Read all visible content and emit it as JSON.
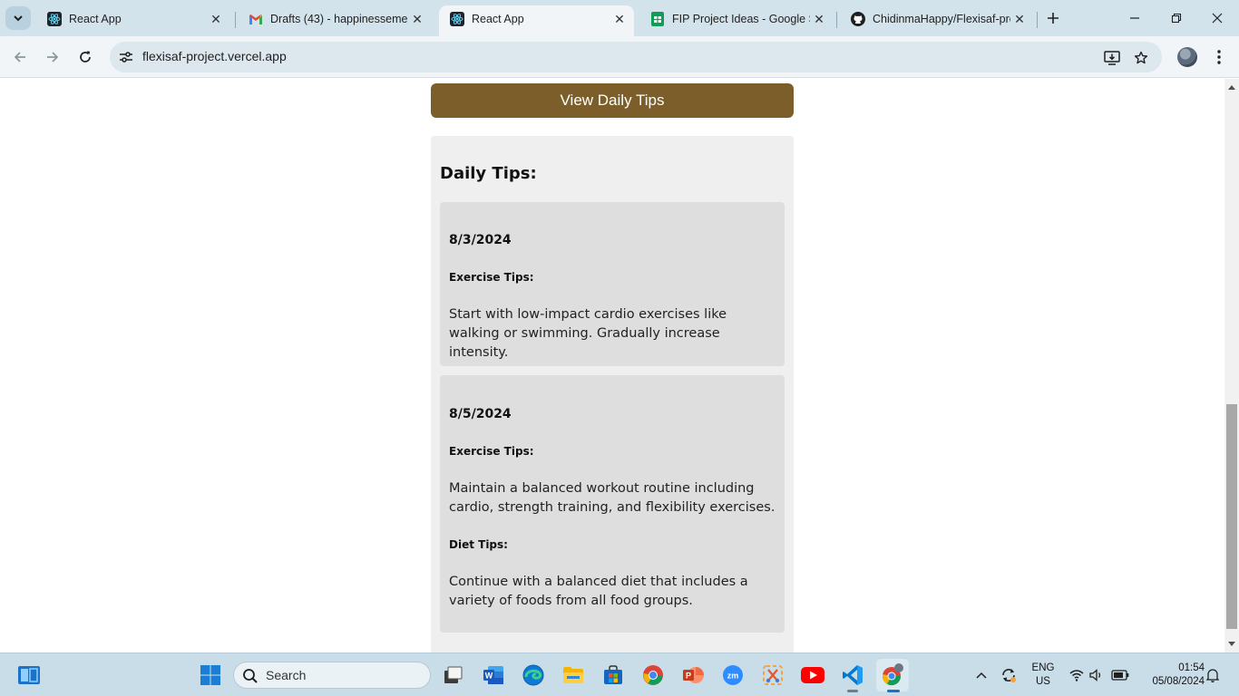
{
  "browser": {
    "tabs": [
      {
        "label": "React App",
        "favicon": "react-icon",
        "active": false
      },
      {
        "label": "Drafts (43) - happinessemeli",
        "favicon": "gmail-icon",
        "active": false
      },
      {
        "label": "React App",
        "favicon": "react-icon",
        "active": true
      },
      {
        "label": "FIP Project Ideas - Google Sl",
        "favicon": "sheets-icon",
        "active": false
      },
      {
        "label": "ChidinmaHappy/Flexisaf-prc",
        "favicon": "github-icon",
        "active": false
      }
    ],
    "url": "flexisaf-project.vercel.app"
  },
  "page": {
    "view_tips_button": "View Daily Tips",
    "tips_heading": "Daily Tips:",
    "tips": [
      {
        "date": "8/3/2024",
        "sections": [
          {
            "label": "Exercise Tips:",
            "text": "Start with low-impact cardio exercises like walking or swimming. Gradually increase intensity."
          }
        ]
      },
      {
        "date": "8/5/2024",
        "sections": [
          {
            "label": "Exercise Tips:",
            "text": "Maintain a balanced workout routine including cardio, strength training, and flexibility exercises."
          },
          {
            "label": "Diet Tips:",
            "text": "Continue with a balanced diet that includes a variety of foods from all food groups."
          }
        ]
      }
    ]
  },
  "taskbar": {
    "search_placeholder": "Search",
    "language_line1": "ENG",
    "language_line2": "US",
    "time": "01:54",
    "date": "05/08/2024"
  },
  "colors": {
    "button_brown": "#7c5e2b",
    "panel_gray": "#efefef",
    "card_gray": "#dedede",
    "tabstrip": "#d3e3ec"
  }
}
